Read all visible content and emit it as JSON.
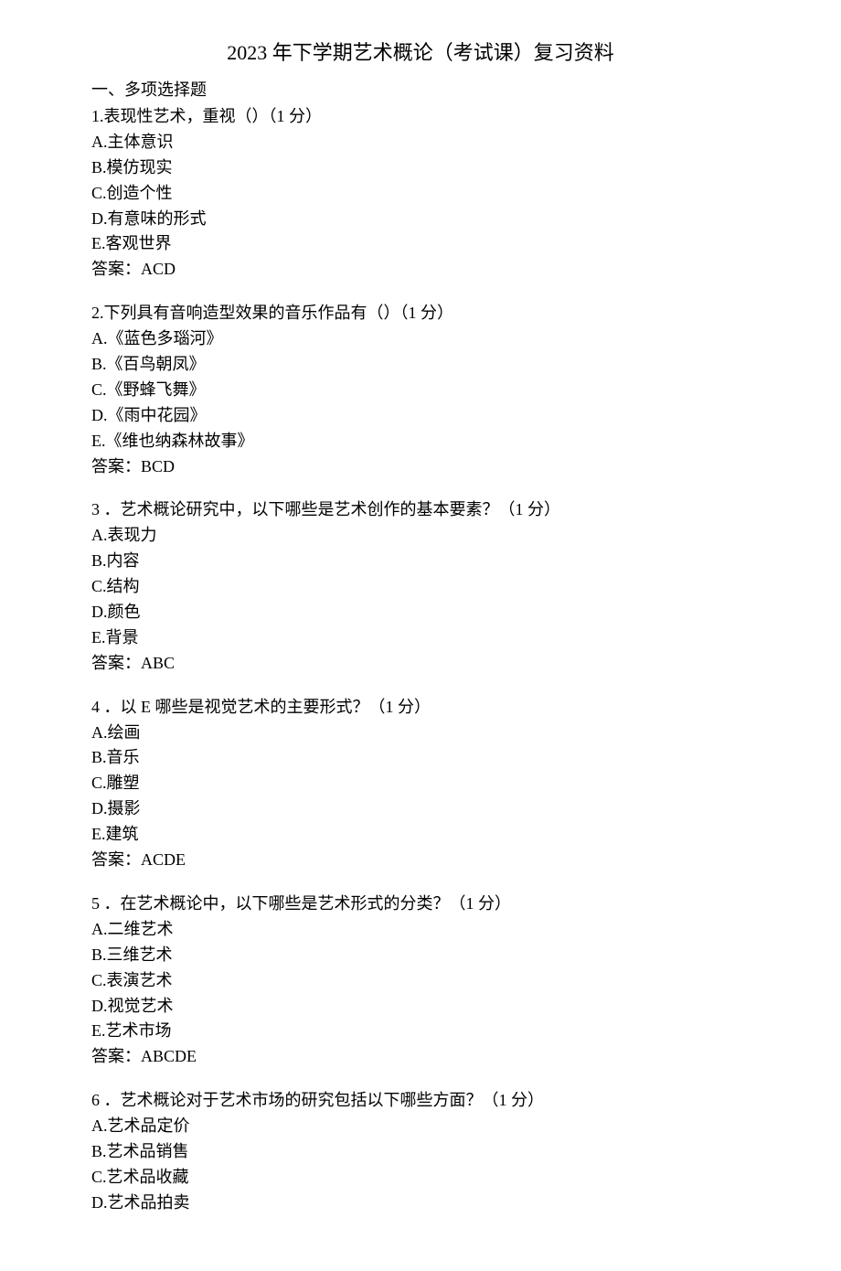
{
  "title": "2023 年下学期艺术概论（考试课）复习资料",
  "section_header": "一、多项选择题",
  "questions": [
    {
      "num": "1.",
      "text": "表现性艺术，重视（）（1 分）",
      "options": [
        "A.主体意识",
        "B.模仿现实",
        "C.创造个性",
        "D.有意味的形式",
        "E.客观世界"
      ],
      "answer": "答案：ACD"
    },
    {
      "num": "2.",
      "text": "下列具有音响造型效果的音乐作品有（）（1 分）",
      "options": [
        "A.《蓝色多瑙河》",
        "B.《百鸟朝凤》",
        "C.《野蜂飞舞》",
        "D.《雨中花园》",
        "E.《维也纳森林故事》"
      ],
      "answer": "答案：BCD"
    },
    {
      "num": "3 ．",
      "text": "艺术概论研究中，以下哪些是艺术创作的基本要素？（1 分）",
      "options": [
        "A.表现力",
        "B.内容",
        "C.结构",
        "D.颜色",
        "E.背景"
      ],
      "answer": "答案：ABC"
    },
    {
      "num": "4 ．",
      "text": "以 E 哪些是视觉艺术的主要形式？（1 分）",
      "options": [
        "A.绘画",
        "B.音乐",
        "C.雕塑",
        "D.摄影",
        "E.建筑"
      ],
      "answer": "答案：ACDE"
    },
    {
      "num": "5 ．",
      "text": "在艺术概论中，以下哪些是艺术形式的分类？（1 分）",
      "options": [
        "A.二维艺术",
        "B.三维艺术",
        "C.表演艺术",
        "D.视觉艺术",
        "E.艺术市场"
      ],
      "answer": "答案：ABCDE"
    },
    {
      "num": "6 ．",
      "text": "艺术概论对于艺术市场的研究包括以下哪些方面？（1 分）",
      "options": [
        "A.艺术品定价",
        "B.艺术品销售",
        "C.艺术品收藏",
        "D.艺术品拍卖"
      ],
      "answer": ""
    }
  ]
}
